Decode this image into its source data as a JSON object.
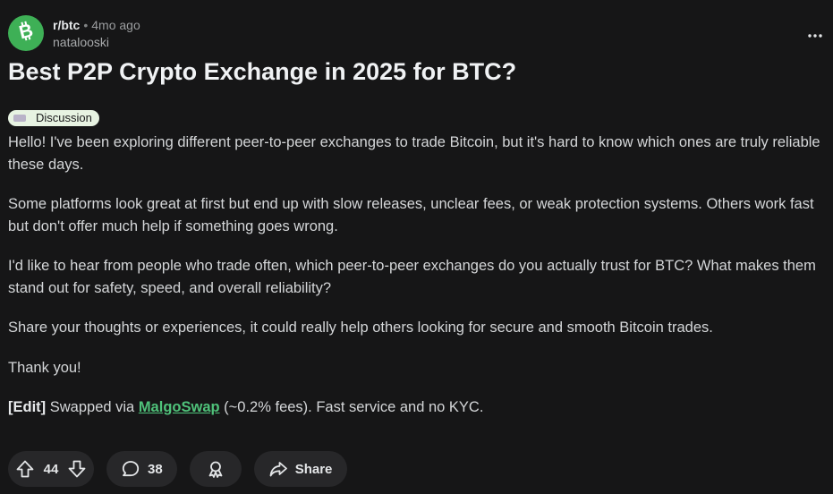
{
  "header": {
    "subreddit": "r/btc",
    "separator": "•",
    "time": "4mo ago",
    "author": "natalooski",
    "avatar_color": "#3eb056",
    "avatar_icon": "bitcoin-cash-icon",
    "more_icon": "more-options-icon"
  },
  "post": {
    "title": "Best P2P Crypto Exchange in 2025 for BTC?",
    "flair": "Discussion",
    "paragraphs": [
      "Hello! I've been exploring different peer-to-peer exchanges to trade Bitcoin, but it's hard to know which ones are truly reliable these days.",
      "Some platforms look great at first but end up with slow releases, unclear fees, or weak protection systems. Others work fast but don't offer much help if something goes wrong.",
      "I'd like to hear from people who trade often, which peer-to-peer exchanges do you actually trust for BTC? What makes them stand out for safety, speed, and overall reliability?",
      "Share your thoughts or experiences, it could really help others looking for secure and smooth Bitcoin trades.",
      "Thank you!"
    ],
    "edit": {
      "tag": "[Edit]",
      "before_link": " Swapped via ",
      "link_text": "MalgoSwap",
      "after_link": " (~0.2% fees). Fast service and no KYC."
    }
  },
  "actions": {
    "vote_count": "44",
    "comment_count": "38",
    "share_label": "Share",
    "upvote_icon": "upvote-icon",
    "downvote_icon": "downvote-icon",
    "comment_icon": "comment-icon",
    "award_icon": "award-icon",
    "share_icon": "share-icon"
  },
  "colors": {
    "background": "#161617",
    "accent_green": "#4fc27a",
    "flair_bg": "#e7f3e2",
    "pill_bg": "#272729"
  }
}
